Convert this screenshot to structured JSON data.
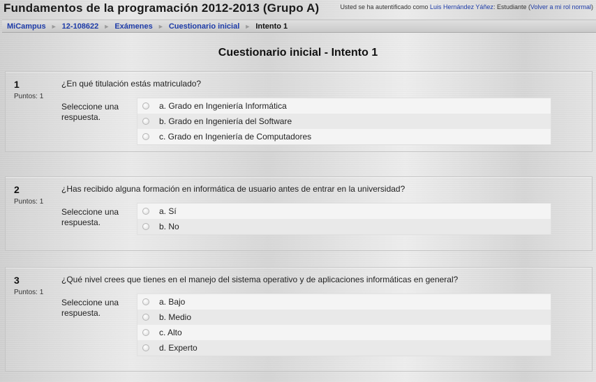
{
  "header": {
    "course_title": "Fundamentos de la programación 2012-2013 (Grupo A)",
    "login_prefix": "Usted se ha autentificado como",
    "user_name": "Luis Hernández Yáñez",
    "role_suffix": ": Estudiante (",
    "back_link": "Volver a mi rol normal",
    "close_paren": ")"
  },
  "breadcrumb": {
    "items": [
      "MiCampus",
      "12-108622",
      "Exámenes",
      "Cuestionario inicial"
    ],
    "current": "Intento 1",
    "separator": "►"
  },
  "page_title": "Cuestionario inicial - Intento 1",
  "questions": [
    {
      "number": "1",
      "points": "Puntos: 1",
      "text": "¿En qué titulación estás matriculado?",
      "prompt": "Seleccione una respuesta.",
      "options": [
        "a. Grado en Ingeniería Informática",
        "b. Grado en Ingeniería del Software",
        "c. Grado en Ingeniería de Computadores"
      ]
    },
    {
      "number": "2",
      "points": "Puntos: 1",
      "text": "¿Has recibido alguna formación en informática de usuario antes de entrar en la universidad?",
      "prompt": "Seleccione una respuesta.",
      "options": [
        "a. Sí",
        "b. No"
      ]
    },
    {
      "number": "3",
      "points": "Puntos: 1",
      "text": "¿Qué nivel crees que tienes en el manejo del sistema operativo y de aplicaciones informáticas en general?",
      "prompt": "Seleccione una respuesta.",
      "options": [
        "a. Bajo",
        "b. Medio",
        "c. Alto",
        "d. Experto"
      ]
    }
  ],
  "icons": {
    "radio": "radio-button-icon",
    "separator": "breadcrumb-separator-icon"
  }
}
